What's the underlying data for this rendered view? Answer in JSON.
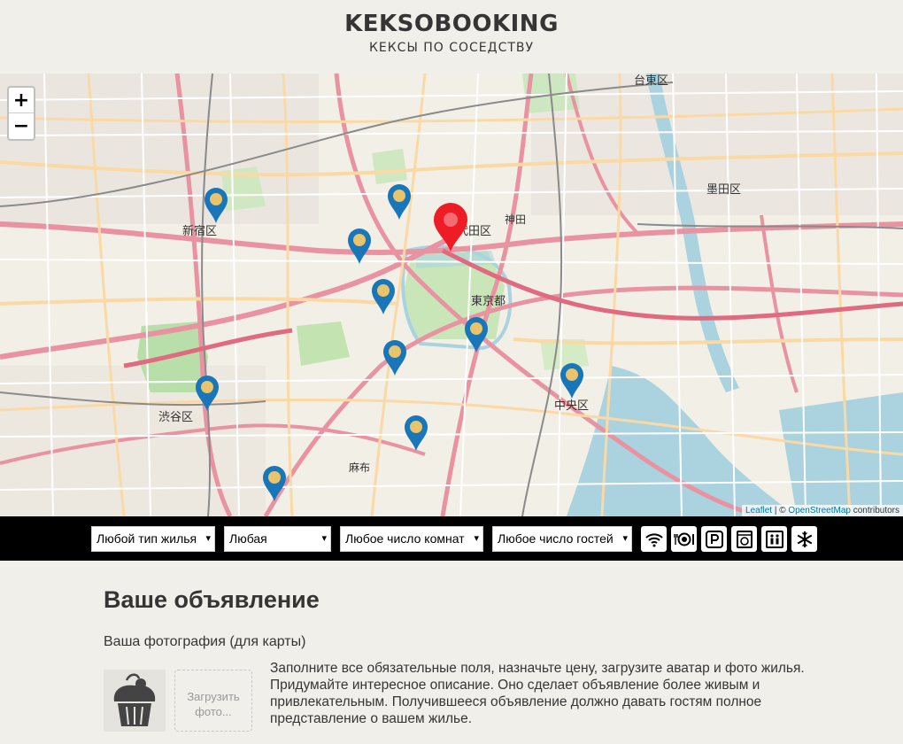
{
  "header": {
    "title": "KEKSOBOOKING",
    "subtitle": "КЕКСЫ ПО СОСЕДСТВУ"
  },
  "map": {
    "zoom_in": "+",
    "zoom_out": "−",
    "attribution": {
      "leaflet": "Leaflet",
      "separator": " | © ",
      "osm": "OpenStreetMap",
      "suffix": " contributors"
    },
    "place_labels": {
      "taito": "台東区",
      "sumida": "墨田区",
      "shinjuku": "新宿区",
      "chiyoda": "千代田区",
      "tokyo_to": "東京都",
      "chuo": "中央区",
      "shibuya": "渋谷区",
      "azabu": "麻布",
      "kanda": "神田"
    },
    "pins": {
      "main": "main-pin",
      "offers": 10
    }
  },
  "filters": {
    "housing_type": "Любой тип жилья",
    "price": "Любая",
    "rooms": "Любое число комнат",
    "guests": "Любое число гостей",
    "features": [
      "wifi-icon",
      "dishwasher-icon",
      "parking-icon",
      "washer-icon",
      "elevator-icon",
      "conditioner-icon"
    ]
  },
  "form": {
    "title": "Ваше объявление",
    "photo_label": "Ваша фотография (для карты)",
    "upload_label": "Загрузить фото...",
    "info": "Заполните все обязательные поля, назначьте цену, загрузите аватар и фото жилья. Придумайте интересное описание. Оно сделает объявление более живым и привлекательным. Получившееся объявление должно давать гостям полное представление о вашем жилье."
  },
  "colors": {
    "background": "#f0efe9",
    "filter_bar": "#000000",
    "main_pin": "#ee1c25",
    "offer_pin": "#1976b8",
    "text": "#353535"
  }
}
